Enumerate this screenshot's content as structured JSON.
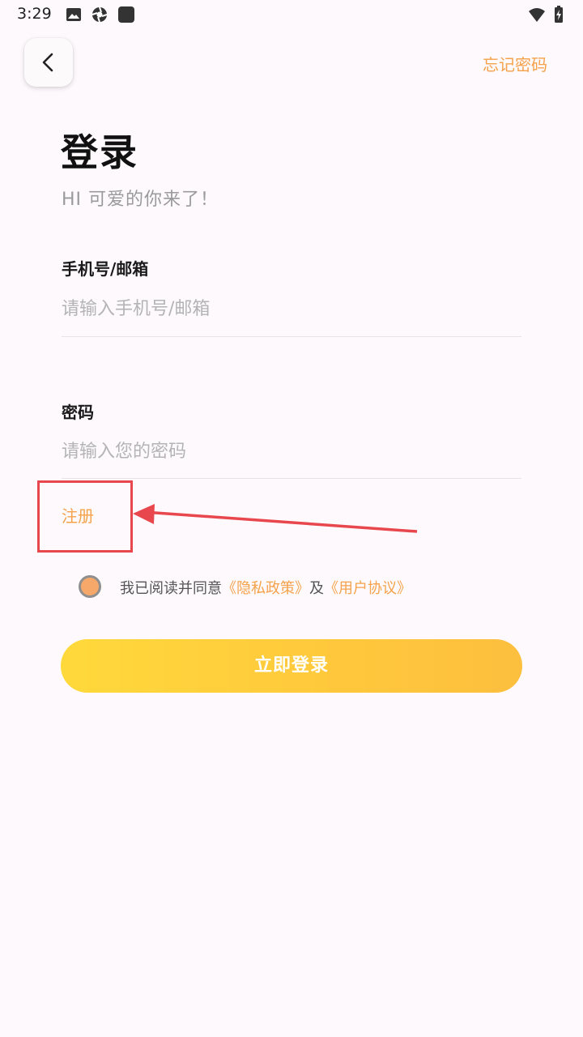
{
  "status_bar": {
    "time": "3:29"
  },
  "header": {
    "forgot_password": "忘记密码"
  },
  "title": "登录",
  "subtitle": "HI 可爱的你来了！",
  "account": {
    "label": "手机号/邮箱",
    "placeholder": "请输入手机号/邮箱",
    "value": ""
  },
  "password": {
    "label": "密码",
    "placeholder": "请输入您的密码",
    "value": ""
  },
  "register": "注册",
  "agreement": {
    "prefix": "我已阅读并同意",
    "privacy": "《隐私政策》",
    "and": "及",
    "terms": "《用户协议》",
    "checked": true
  },
  "login_button": "立即登录",
  "colors": {
    "accent": "#f5a24b",
    "button_start": "#ffd93b",
    "button_end": "#fdbf3e",
    "annotation": "#e8484d",
    "background": "#fdf9fc"
  },
  "icons": {
    "back": "chevron-left-icon",
    "image": "image-icon",
    "aperture": "aperture-icon",
    "app": "app-square-icon",
    "wifi": "wifi-icon",
    "battery": "battery-charging-icon"
  }
}
